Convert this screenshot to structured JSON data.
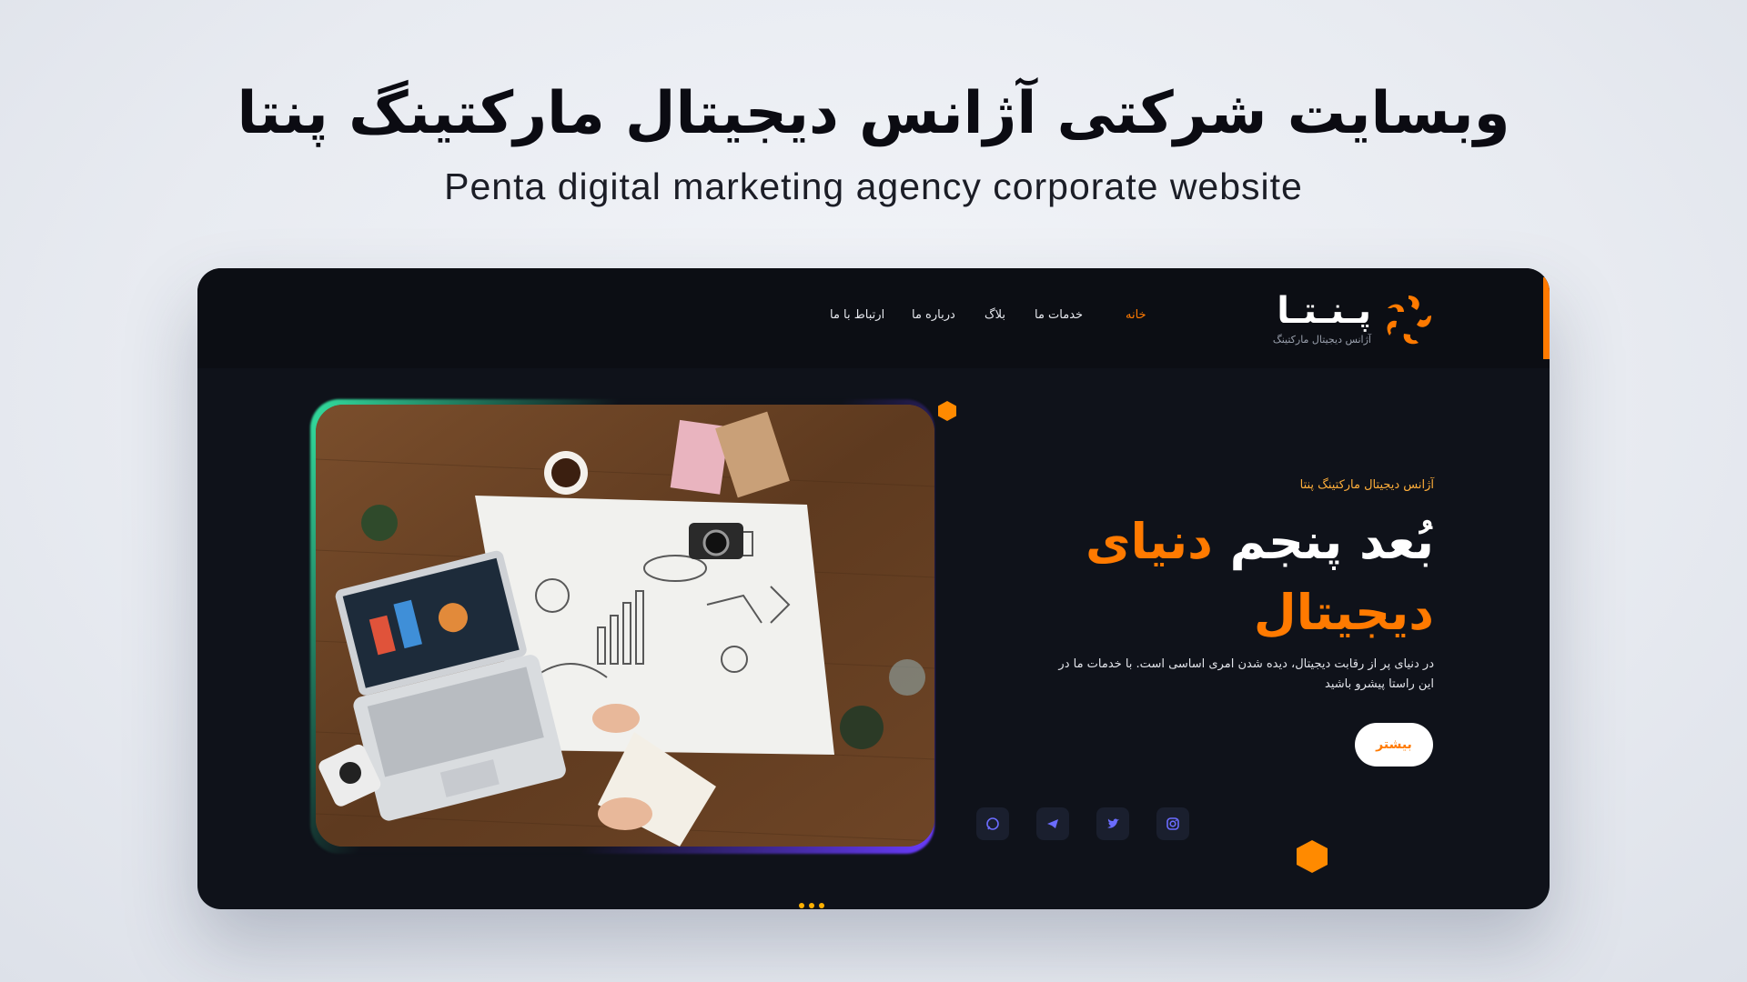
{
  "banner": {
    "title_fa": "وبسایت شرکتی آژانس دیجیتال مارکتینگ پنتا",
    "subtitle_en": "Penta digital marketing agency corporate website"
  },
  "logo": {
    "name": "پـنـتـا",
    "tagline": "آژانس دیجیتال مارکتینگ"
  },
  "nav": {
    "items": [
      {
        "label": "خانه",
        "active": true
      },
      {
        "label": "خدمات ما",
        "active": false
      },
      {
        "label": "بلاگ",
        "active": false
      },
      {
        "label": "درباره ما",
        "active": false
      },
      {
        "label": "ارتباط با ما",
        "active": false
      }
    ]
  },
  "hero": {
    "eyebrow": "آژانس دیجیتال مارکتینگ پنتا",
    "title_part1": "بُعد پنجم",
    "title_part2": "دنیای",
    "title_part3": "دیجیتال",
    "description": "در دنیای پر از رقابت دیجیتال، دیده شدن امری اساسی است. با خدمات ما در این راستا پیشرو باشید",
    "cta_label": "بیشتر"
  },
  "social": [
    "whatsapp-icon",
    "telegram-icon",
    "twitter-icon",
    "instagram-icon"
  ],
  "colors": {
    "accent": "#ff7a00",
    "background": "#0f121a",
    "social_icon": "#6b6cff"
  }
}
